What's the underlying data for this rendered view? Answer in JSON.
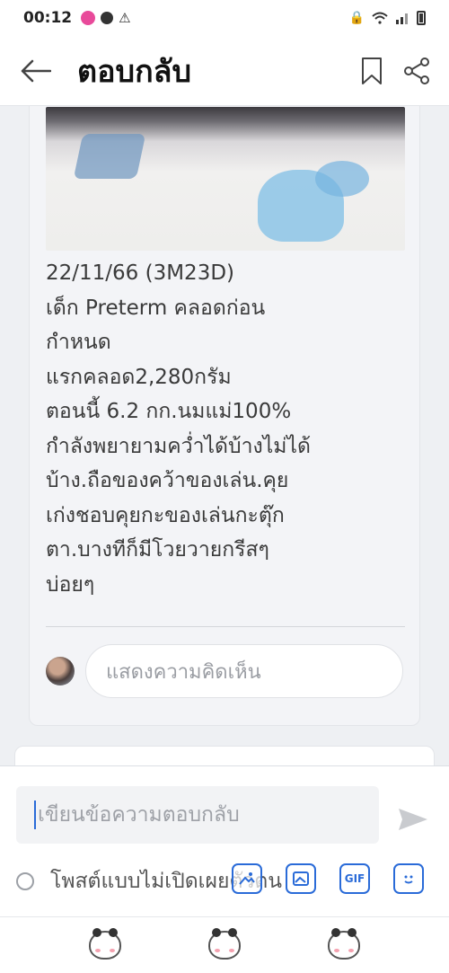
{
  "status_bar": {
    "time": "00:12",
    "app_badge": "ไลน์"
  },
  "header": {
    "title": "ตอบกลับ"
  },
  "post": {
    "text": "22/11/66 (3M23D)\nเด็ก Preterm คลอดก่อน\nกำหนด\nแรกคลอด2,280กรัม\nตอนนี้ 6.2 กก.นมแม่100%\nกำลังพยายามคว่ำได้บ้างไม่ได้\nบ้าง.ถือของคว้าของเล่น.คุย\nเก่งชอบคุยกะของเล่นกะตุ๊ก\nตา.บางทีก็มีโวยวายกรีสๆ\nบ่อยๆ"
  },
  "comment": {
    "placeholder": "แสดงความคิดเห็น"
  },
  "composer": {
    "reply_placeholder": "เขียนข้อความตอบกลับ",
    "anonymous_label": "โพสต์แบบไม่เปิดเผยตัวตน",
    "gif_label": "GIF"
  },
  "colors": {
    "accent": "#2a6bd8"
  }
}
